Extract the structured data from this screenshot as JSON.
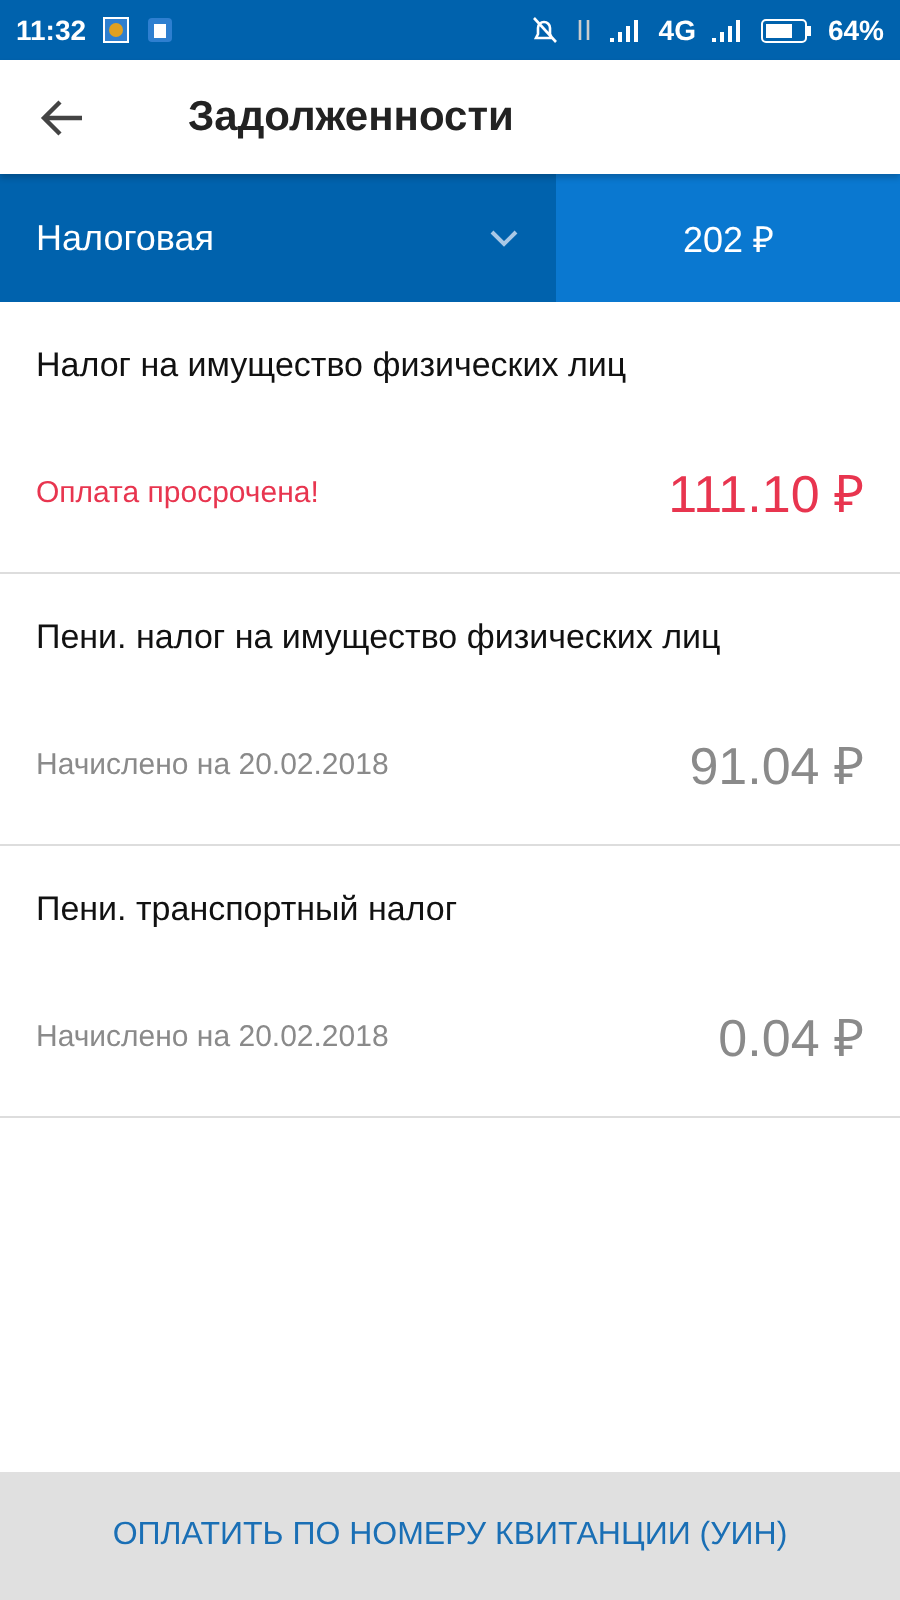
{
  "status_bar": {
    "time": "11:32",
    "network": "4G",
    "battery": "64%"
  },
  "header": {
    "title": "Задолженности"
  },
  "filter": {
    "selected_label": "Налоговая",
    "total": "202 ₽"
  },
  "debts": [
    {
      "title": "Налог на имущество физических лиц",
      "kind": "overdue",
      "note": "Оплата просрочена!",
      "amount": "111.10 ₽"
    },
    {
      "title": "Пени. налог на имущество физических лиц",
      "kind": "accrued",
      "note": "Начислено на 20.02.2018",
      "amount": "91.04 ₽"
    },
    {
      "title": "Пени. транспортный налог",
      "kind": "accrued",
      "note": "Начислено на 20.02.2018",
      "amount": "0.04 ₽"
    }
  ],
  "footer_button": "ОПЛАТИТЬ ПО НОМЕРУ КВИТАНЦИИ (УИН)"
}
